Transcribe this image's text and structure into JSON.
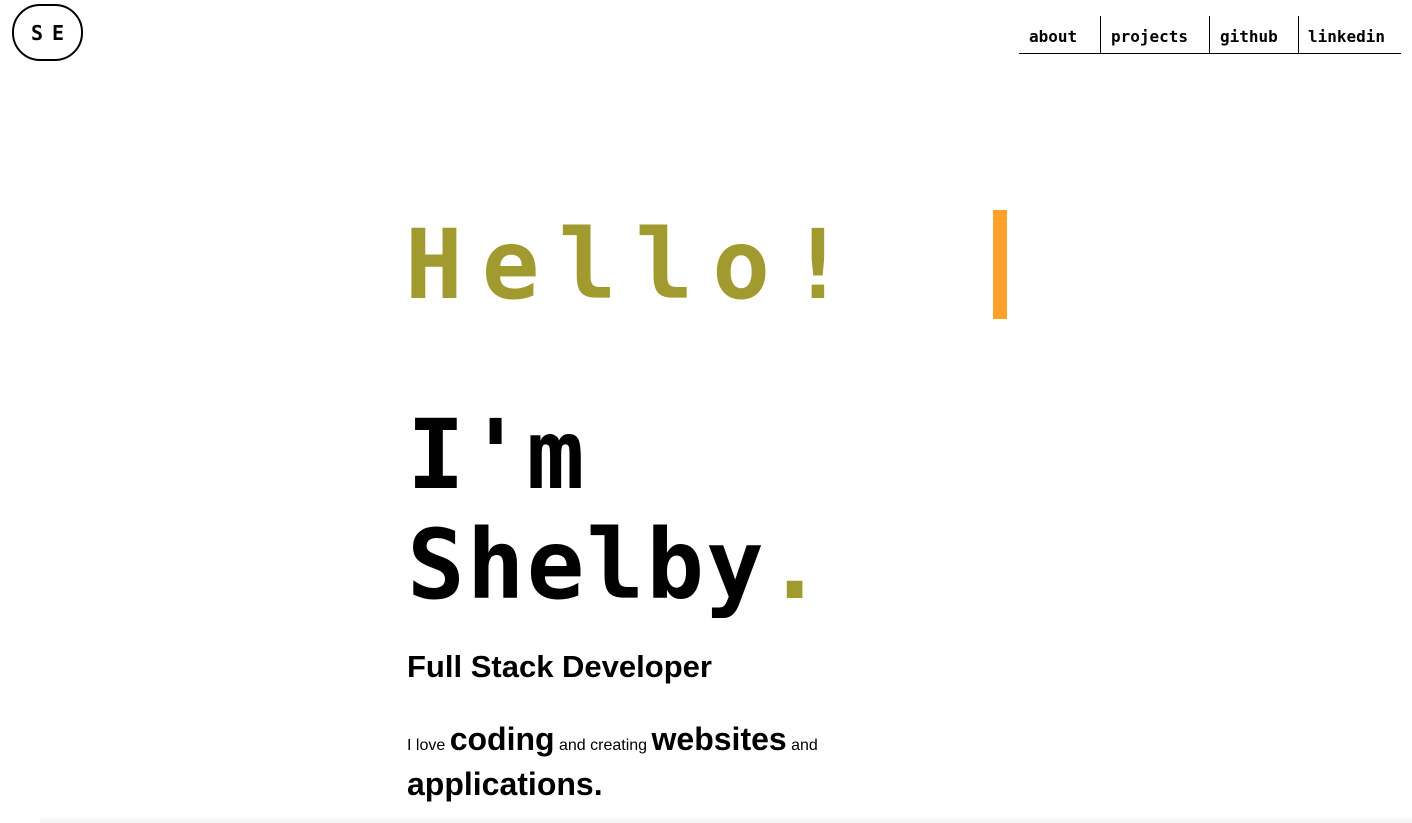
{
  "logo": {
    "text": "SE"
  },
  "nav": {
    "items": [
      {
        "label": "about"
      },
      {
        "label": "projects"
      },
      {
        "label": "github"
      },
      {
        "label": "linkedin"
      }
    ]
  },
  "hero": {
    "greeting": "Hello!",
    "intro_line1": "I'm",
    "intro_name": "Shelby",
    "intro_punct": ".",
    "role": "Full Stack Developer",
    "blurb": {
      "part1": "I love ",
      "word1": "coding",
      "part2": " and creating ",
      "word2": "websites",
      "part3": " and",
      "word3": "applications."
    }
  },
  "colors": {
    "accent_olive": "#a19a2e",
    "cursor_orange": "#ffa12b",
    "text": "#000000",
    "background": "#ffffff"
  }
}
